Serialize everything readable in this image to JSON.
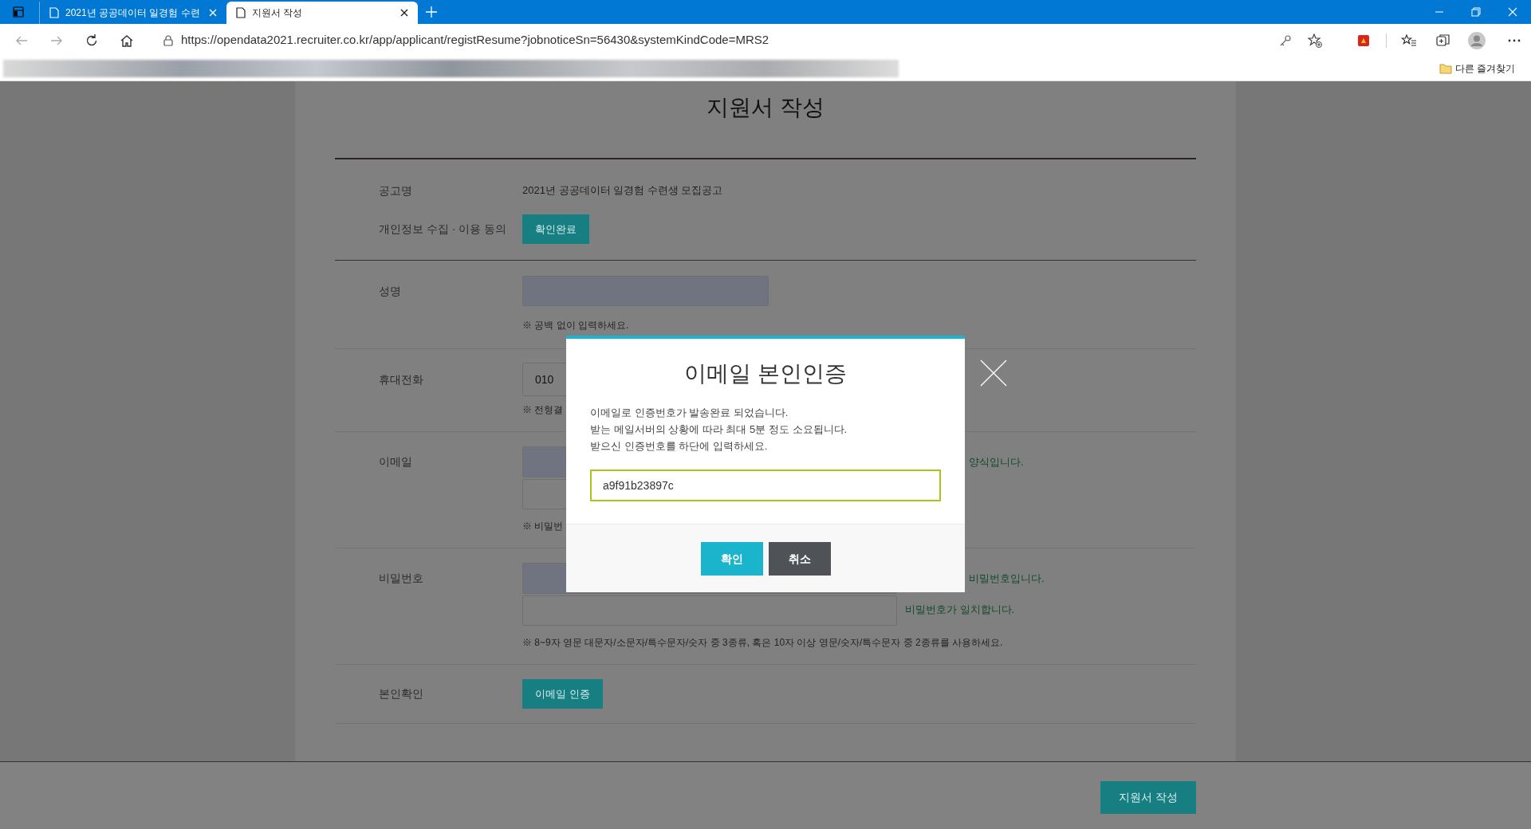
{
  "browser": {
    "tabs": [
      {
        "title": "2021년 공공데이터 일경험 수련",
        "selected": false
      },
      {
        "title": "지원서 작성",
        "selected": true
      }
    ],
    "url": "https://opendata2021.recruiter.co.kr/app/applicant/registResume?jobnoticeSn=56430&systemKindCode=MRS2",
    "bookmarks_folder": "다른 즐겨찾기"
  },
  "page": {
    "title": "지원서 작성",
    "sections": [
      {
        "rows": [
          {
            "kind": "text",
            "label": "공고명",
            "value": "2021년 공공데이터 일경험 수련생 모집공고"
          },
          {
            "kind": "button",
            "label": "개인정보 수집 · 이용 동의",
            "button": "확인완료"
          }
        ]
      },
      {
        "rows": [
          {
            "kind": "single",
            "label": "성명",
            "note": "※ 공백 없이 입력하세요."
          },
          {
            "kind": "phone",
            "label": "휴대전화",
            "value": "010",
            "note": "※ 전형결"
          },
          {
            "kind": "double",
            "label": "이메일",
            "messages": [
              "양식입니다."
            ],
            "note": "※ 비밀번"
          },
          {
            "kind": "double",
            "label": "비밀번호",
            "messages": [
              "비밀번호입니다.",
              "비밀번호가 일치합니다."
            ],
            "note": "※ 8~9자 영문 대문자/소문자/특수문자/숫자 중 3종류, 혹은 10자 이상 영문/숫자/특수문자 중 2종류를 사용하세요."
          },
          {
            "kind": "button",
            "label": "본인확인",
            "button": "이메일 인증"
          }
        ]
      }
    ],
    "submit": "지원서 작성"
  },
  "modal": {
    "title": "이메일 본인인증",
    "lines": [
      "이메일로 인증번호가 발송완료 되었습니다.",
      "받는 메일서버의 상황에 따라 최대 5분 정도 소요됩니다.",
      "받으신 인증번호를 하단에 입력하세요."
    ],
    "code": "a9f91b23897c",
    "buttons": [
      {
        "label": "확인",
        "kind": "primary"
      },
      {
        "label": "취소",
        "kind": "secondary"
      }
    ]
  }
}
